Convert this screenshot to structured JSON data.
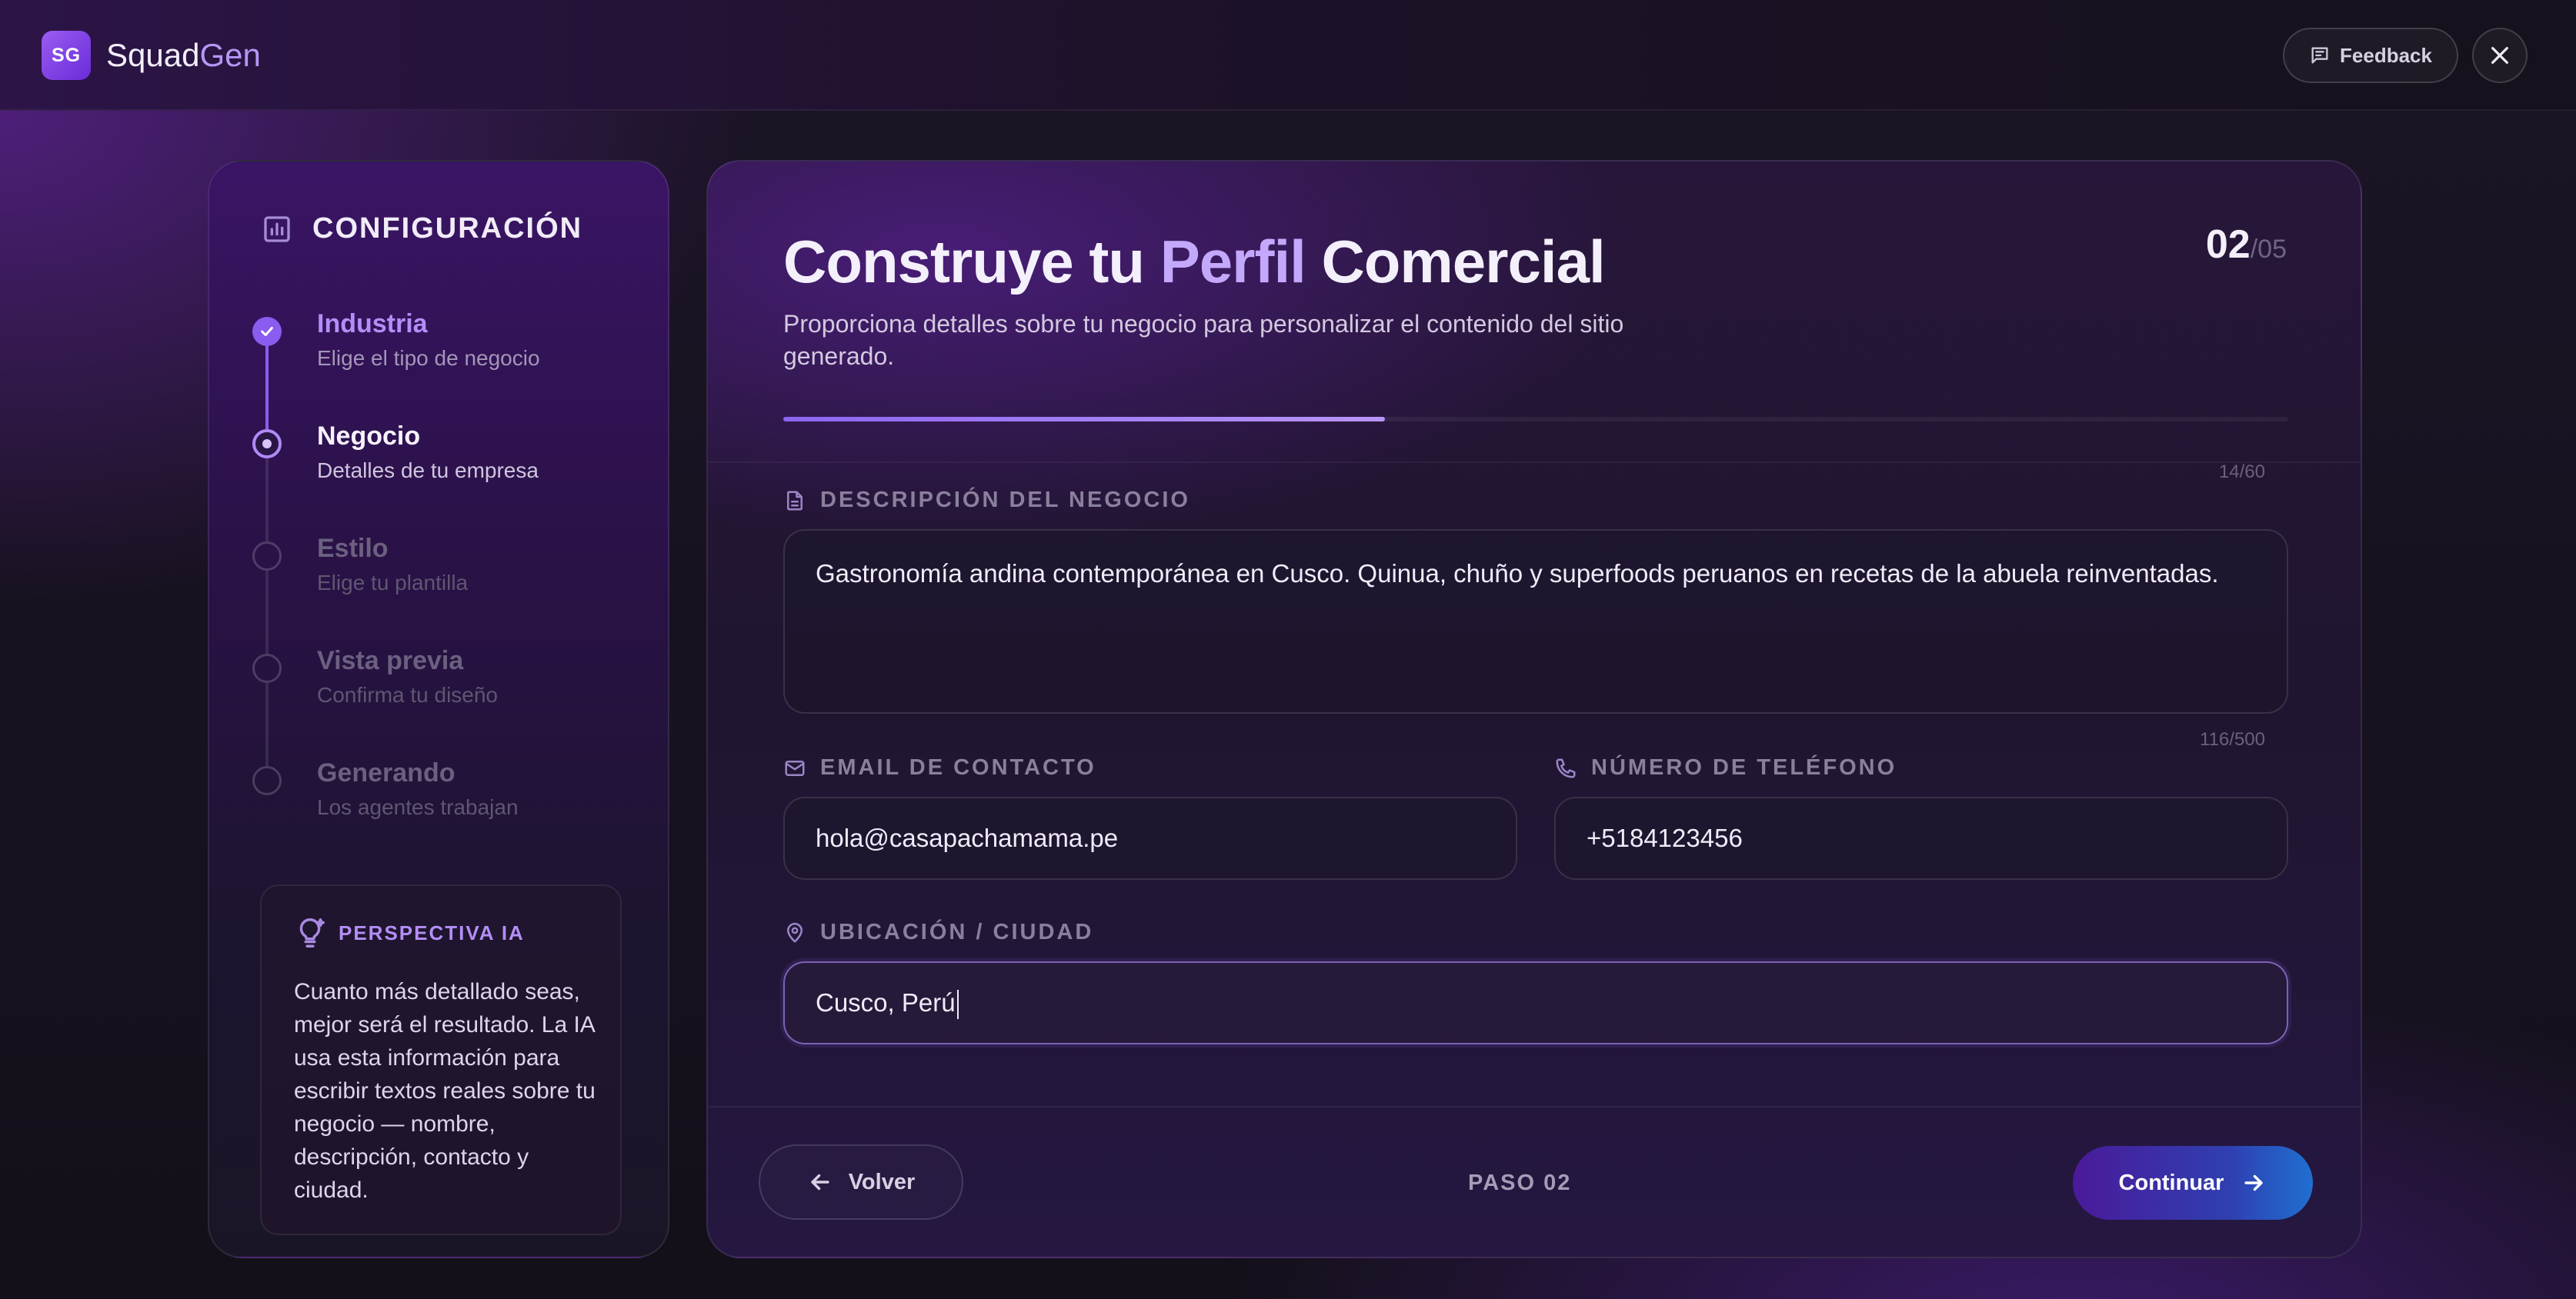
{
  "app": {
    "logo_initials": "SG",
    "name_part1": "Squad",
    "name_part2": "Gen"
  },
  "header": {
    "feedback_label": "Feedback"
  },
  "sidebar": {
    "title": "CONFIGURACIÓN",
    "steps": [
      {
        "name": "Industria",
        "desc": "Elige el tipo de negocio",
        "state": "completed"
      },
      {
        "name": "Negocio",
        "desc": "Detalles de tu empresa",
        "state": "active"
      },
      {
        "name": "Estilo",
        "desc": "Elige tu plantilla",
        "state": "pending"
      },
      {
        "name": "Vista previa",
        "desc": "Confirma tu diseño",
        "state": "pending"
      },
      {
        "name": "Generando",
        "desc": "Los agentes trabajan",
        "state": "pending"
      }
    ],
    "insight": {
      "title": "PERSPECTIVA IA",
      "body": "Cuanto más detallado seas, mejor será el resultado. La IA usa esta información para escribir textos reales sobre tu negocio — nombre, descripción, contacto y ciudad."
    }
  },
  "main": {
    "title_part1": "Construye tu ",
    "title_highlight": "Perfil",
    "title_part2": " Comercial",
    "step_current": "02",
    "step_total": "/05",
    "subtitle": "Proporciona detalles sobre tu negocio para personalizar el contenido del sitio generado.",
    "progress_fraction": 0.4,
    "fields": {
      "name_counter": "14/60",
      "description": {
        "label": "DESCRIPCIÓN DEL NEGOCIO",
        "value": "Gastronomía andina contemporánea en Cusco. Quinua, chuño y superfoods peruanos en recetas de la abuela reinventadas.",
        "counter": "116/500"
      },
      "email": {
        "label": "EMAIL DE CONTACTO",
        "value": "hola@casapachamama.pe"
      },
      "phone": {
        "label": "NÚMERO DE TELÉFONO",
        "value": "+5184123456"
      },
      "location": {
        "label": "UBICACIÓN / CIUDAD",
        "value": "Cusco, Perú"
      }
    }
  },
  "footer": {
    "back_label": "Volver",
    "step_label": "PASO 02",
    "next_label": "Continuar"
  },
  "colors": {
    "accent": "#8b5cf0",
    "accent_light": "#c3a8fb",
    "cta_start": "#4a1a9a",
    "cta_end": "#1f6fd0"
  }
}
